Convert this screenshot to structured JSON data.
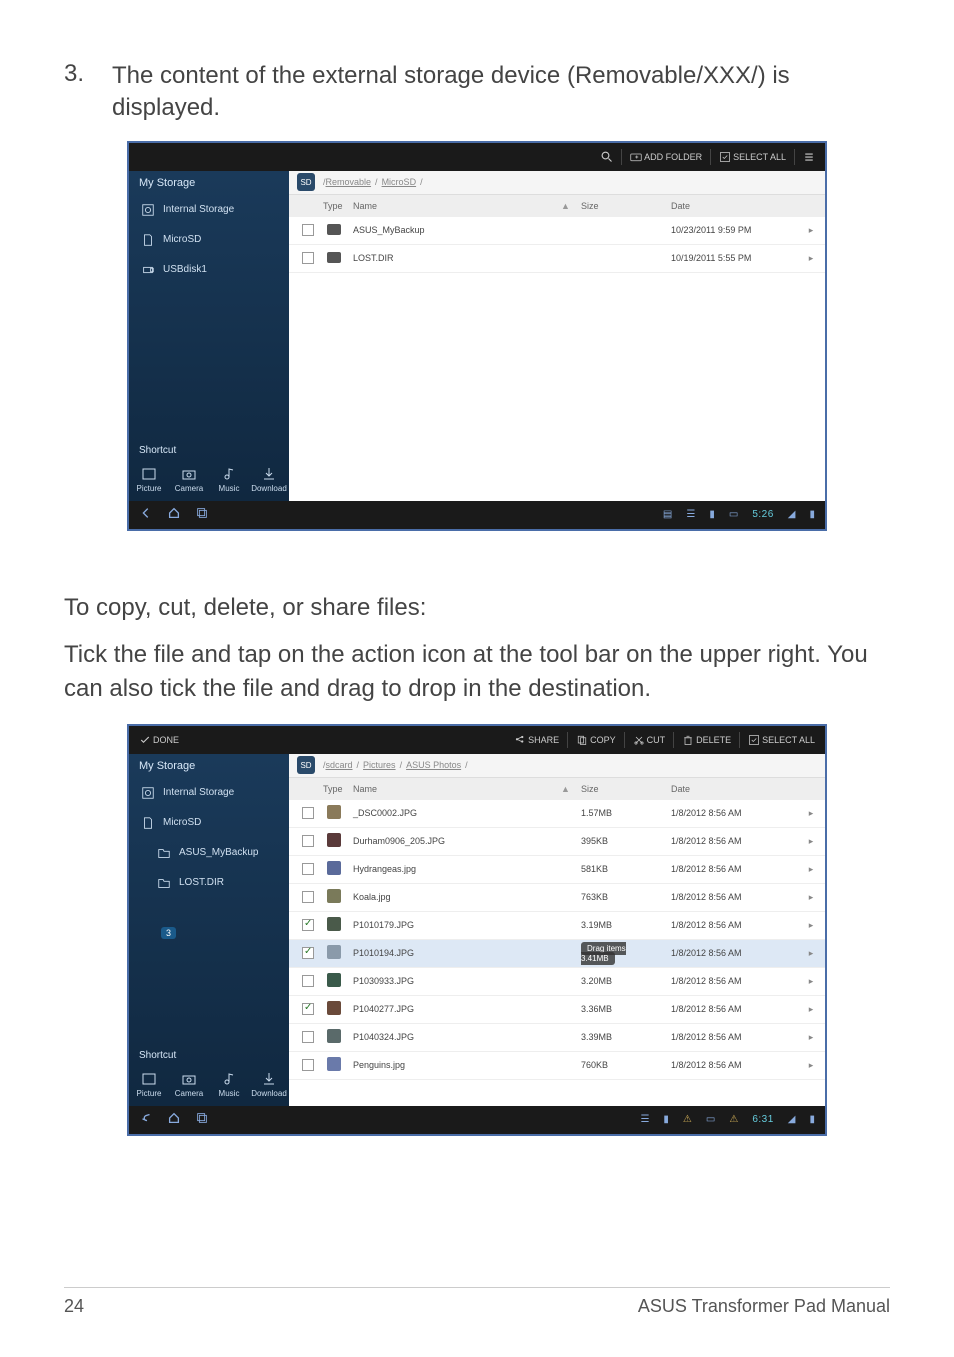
{
  "step": {
    "number": "3.",
    "text": "The content of the external storage device (Removable/XXX/) is displayed."
  },
  "shot1": {
    "toolbar": {
      "search_icon": "search-icon",
      "add_folder": "ADD FOLDER",
      "select_all": "SELECT ALL"
    },
    "sidebar": {
      "title": "My Storage",
      "items": [
        {
          "label": "Internal Storage"
        },
        {
          "label": "MicroSD"
        },
        {
          "label": "USBdisk1"
        }
      ],
      "shortcut_title": "Shortcut",
      "shortcuts": [
        {
          "label": "Picture"
        },
        {
          "label": "Camera"
        },
        {
          "label": "Music"
        },
        {
          "label": "Download"
        }
      ]
    },
    "breadcrumb": {
      "seg1": "Removable",
      "seg2": "MicroSD"
    },
    "headers": {
      "type": "Type",
      "name": "Name",
      "size": "Size",
      "date": "Date"
    },
    "rows": [
      {
        "name": "ASUS_MyBackup",
        "size": "",
        "date": "10/23/2011 9:59 PM"
      },
      {
        "name": "LOST.DIR",
        "size": "",
        "date": "10/19/2011 5:55 PM"
      }
    ],
    "clock": "5:26"
  },
  "copy_heading": "To copy, cut, delete, or share files:",
  "copy_body": "Tick the file and tap on the action icon at the tool bar on the upper right. You can also tick the file and drag to drop in the destination.",
  "shot2": {
    "toolbar": {
      "done": "DONE",
      "share": "SHARE",
      "copy": "COPY",
      "cut": "CUT",
      "delete": "DELETE",
      "select_all": "SELECT ALL"
    },
    "sidebar": {
      "title": "My Storage",
      "items": [
        {
          "label": "Internal Storage"
        },
        {
          "label": "MicroSD"
        },
        {
          "label": "ASUS_MyBackup",
          "nested": true
        },
        {
          "label": "LOST.DIR",
          "nested": true
        }
      ],
      "badge": "3",
      "shortcut_title": "Shortcut",
      "shortcuts": [
        {
          "label": "Picture"
        },
        {
          "label": "Camera"
        },
        {
          "label": "Music"
        },
        {
          "label": "Download"
        }
      ]
    },
    "breadcrumb": {
      "seg1": "sdcard",
      "seg2": "Pictures",
      "seg3": "ASUS Photos"
    },
    "headers": {
      "type": "Type",
      "name": "Name",
      "size": "Size",
      "date": "Date"
    },
    "rows": [
      {
        "checked": false,
        "name": "_DSC0002.JPG",
        "size": "1.57MB",
        "date": "1/8/2012 8:56 AM",
        "thumb": "#8a7a5a"
      },
      {
        "checked": false,
        "name": "Durham0906_205.JPG",
        "size": "395KB",
        "date": "1/8/2012 8:56 AM",
        "thumb": "#5a3a3a"
      },
      {
        "checked": false,
        "name": "Hydrangeas.jpg",
        "size": "581KB",
        "date": "1/8/2012 8:56 AM",
        "thumb": "#5a6a9a"
      },
      {
        "checked": false,
        "name": "Koala.jpg",
        "size": "763KB",
        "date": "1/8/2012 8:56 AM",
        "thumb": "#7a7a5a"
      },
      {
        "checked": true,
        "name": "P1010179.JPG",
        "size": "3.19MB",
        "date": "1/8/2012 8:56 AM",
        "thumb": "#4a5a4a"
      },
      {
        "checked": true,
        "name": "P1010194.JPG",
        "size": "",
        "date": "1/8/2012 8:56 AM",
        "thumb": "#8a9aaa",
        "selected": true,
        "drag_label": "Drag items",
        "drag_sub": "3.41MB"
      },
      {
        "checked": false,
        "name": "P1030933.JPG",
        "size": "3.20MB",
        "date": "1/8/2012 8:56 AM",
        "thumb": "#3a5a4a"
      },
      {
        "checked": true,
        "name": "P1040277.JPG",
        "size": "3.36MB",
        "date": "1/8/2012 8:56 AM",
        "thumb": "#6a4a3a"
      },
      {
        "checked": false,
        "name": "P1040324.JPG",
        "size": "3.39MB",
        "date": "1/8/2012 8:56 AM",
        "thumb": "#5a6a6a"
      },
      {
        "checked": false,
        "name": "Penguins.jpg",
        "size": "760KB",
        "date": "1/8/2012 8:56 AM",
        "thumb": "#6a7aaa"
      }
    ],
    "clock": "6:31"
  },
  "footer": {
    "page": "24",
    "title": "ASUS Transformer Pad Manual"
  }
}
